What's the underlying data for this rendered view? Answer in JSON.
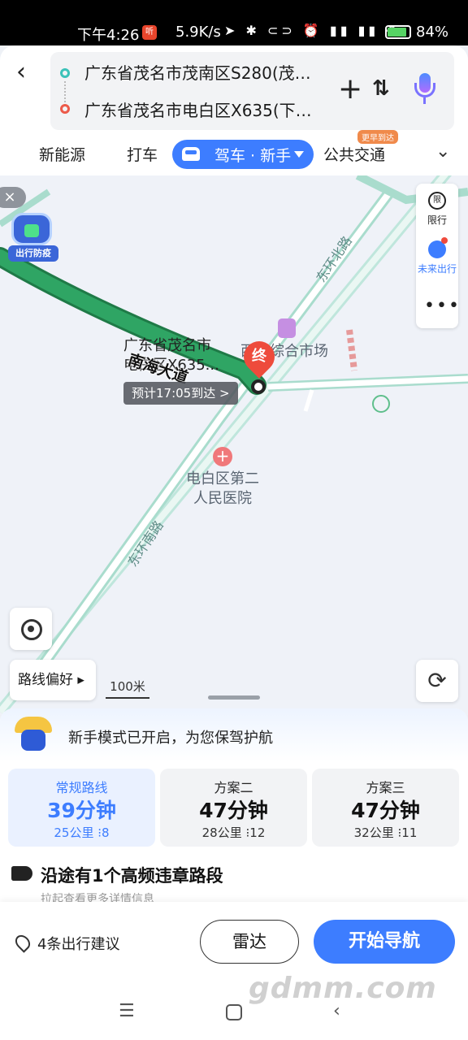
{
  "status_bar": {
    "time": "下午4:26",
    "notification_badge": "听",
    "net_speed": "5.9K/s",
    "battery_pct": "84%"
  },
  "search": {
    "start": "广东省茂名市茂南区S280(茂…",
    "end": "广东省茂名市电白区X635(下…"
  },
  "tabs": {
    "items": [
      "新能源",
      "打车",
      "驾车 · 新手",
      "公共交通"
    ],
    "badge": "更早到达",
    "active_index": 2
  },
  "map": {
    "close_label": "×",
    "robot_label": "出行防疫",
    "right_panel": {
      "limit_icon_text": "限",
      "limit_label": "限行",
      "future_label": "未来出行",
      "more_label": "•••"
    },
    "destination_label": "广东省茂名市电白区X635...",
    "road_name": "南海大道",
    "eta": "预计17:05到达 >",
    "end_marker": "终",
    "poi_market": "西山综合市场",
    "poi_hospital": "电白区第二人民医院",
    "road_north": "东环北路",
    "road_south": "东环南路",
    "pref_label": "路线偏好 ▸",
    "scale": "100米"
  },
  "sheet": {
    "tip": "新手模式已开启，为您保驾护航",
    "routes": [
      {
        "name": "常规路线",
        "time": "39分钟",
        "distance": "25公里",
        "lights": "8"
      },
      {
        "name": "方案二",
        "time": "47分钟",
        "distance": "28公里",
        "lights": "12"
      },
      {
        "name": "方案三",
        "time": "47分钟",
        "distance": "32公里",
        "lights": "11"
      }
    ],
    "selected_route": 0,
    "warning": "沿途有1个高频违章路段",
    "warning_sub": "拉起查看更多详情信息",
    "suggestions": "4条出行建议",
    "radar_button": "雷达",
    "start_button": "开始导航"
  },
  "watermark": "gdmm.com",
  "colors": {
    "primary": "#3d7dff",
    "route_green": "#2fa564",
    "end_red": "#ee4b3c"
  }
}
